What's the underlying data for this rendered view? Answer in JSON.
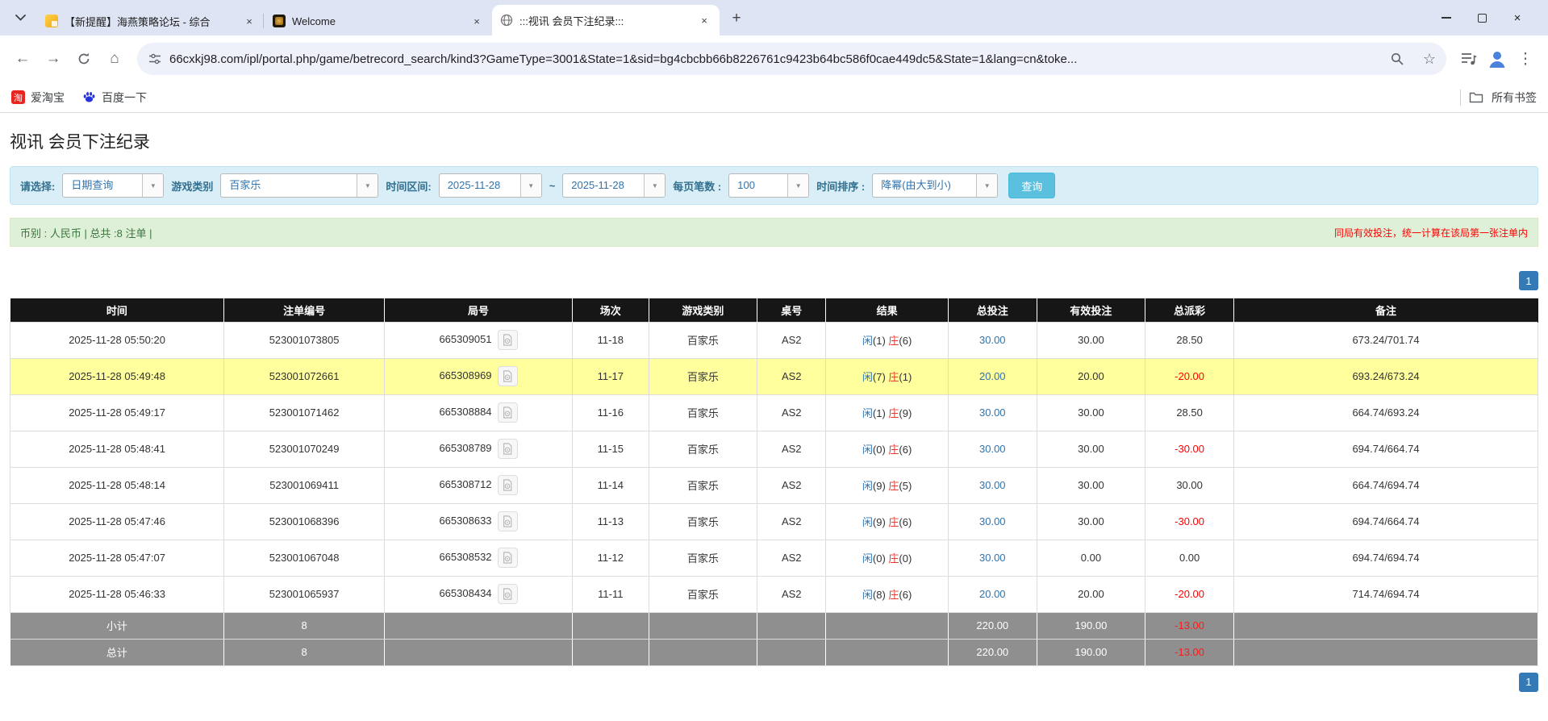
{
  "colors": {
    "accent_blue": "#337ab7",
    "link_blue": "#3173ad",
    "search_button": "#5bc0de",
    "row_highlight": "#ffff9e",
    "negative_red": "#ff0000",
    "result_zhuang_red": "#e03a2f",
    "table_header_bg": "#161616",
    "table_footer_bg": "#8f8f8f",
    "summary_bg": "#dff0d8",
    "filter_bg": "#daeef7"
  },
  "browser": {
    "tabs": [
      {
        "title": "【新提醒】海燕策略论坛 - 综合",
        "favicon": "gold-square-icon"
      },
      {
        "title": "Welcome",
        "favicon": "dark-gold-icon"
      },
      {
        "title": ":::视讯 会员下注纪录:::",
        "favicon": "globe-icon"
      }
    ],
    "icons": {
      "close_glyph": "×",
      "new_tab_glyph": "+",
      "back_glyph": "←",
      "forward_glyph": "→",
      "home_glyph": "⌂",
      "star_glyph": "☆",
      "kebab_glyph": "⋮",
      "dropdown_glyph": "▼"
    },
    "url": "66cxkj98.com/ipl/portal.php/game/betrecord_search/kind3?GameType=3001&State=1&sid=bg4cbcbb66b8226761c9423b64bc586f0cae449dc5&State=1&lang=cn&toke...",
    "bookmarks": {
      "items": [
        {
          "label": "爱淘宝",
          "icon_text": "淘"
        },
        {
          "label": "百度一下"
        }
      ],
      "all_bookmarks_label": "所有书签"
    }
  },
  "page": {
    "title": "视讯 会员下注纪录",
    "filters": {
      "select_label": "请选择:",
      "select_value": "日期查询",
      "game_type_label": "游戏类别",
      "game_type_value": "百家乐",
      "date_range_label": "时间区间:",
      "date_from": "2025-11-28",
      "tilde": "~",
      "date_to": "2025-11-28",
      "page_size_label": "每页笔数 :",
      "page_size_value": "100",
      "sort_label": "时间排序 :",
      "sort_value": "降幂(由大到小)",
      "search_button_label": "查询"
    },
    "summary": {
      "left": "币别 : 人民币 | 总共 :8 注单 |",
      "right": "同局有效投注，统一计算在该局第一张注单内"
    },
    "pagination": {
      "current": "1"
    },
    "table": {
      "headers": [
        "时间",
        "注单编号",
        "局号",
        "场次",
        "游戏类别",
        "桌号",
        "结果",
        "总投注",
        "有效投注",
        "总派彩",
        "备注"
      ],
      "rows": [
        {
          "time": "2025-11-28 05:50:20",
          "bet_no": "523001073805",
          "round_no": "665309051",
          "session": "11-18",
          "game": "百家乐",
          "table_no": "AS2",
          "xian": "闲",
          "xian_n": "(1)",
          "zhuang": "庄",
          "zhuang_n": "(6)",
          "total_bet": "30.00",
          "valid_bet": "30.00",
          "payout": "28.50",
          "payout_class": "",
          "row_class": "",
          "remark": "673.24/701.74"
        },
        {
          "time": "2025-11-28 05:49:48",
          "bet_no": "523001072661",
          "round_no": "665308969",
          "session": "11-17",
          "game": "百家乐",
          "table_no": "AS2",
          "xian": "闲",
          "xian_n": "(7)",
          "zhuang": "庄",
          "zhuang_n": "(1)",
          "total_bet": "20.00",
          "valid_bet": "20.00",
          "payout": "-20.00",
          "payout_class": "neg",
          "row_class": "highlight",
          "remark": "693.24/673.24"
        },
        {
          "time": "2025-11-28 05:49:17",
          "bet_no": "523001071462",
          "round_no": "665308884",
          "session": "11-16",
          "game": "百家乐",
          "table_no": "AS2",
          "xian": "闲",
          "xian_n": "(1)",
          "zhuang": "庄",
          "zhuang_n": "(9)",
          "total_bet": "30.00",
          "valid_bet": "30.00",
          "payout": "28.50",
          "payout_class": "",
          "row_class": "",
          "remark": "664.74/693.24"
        },
        {
          "time": "2025-11-28 05:48:41",
          "bet_no": "523001070249",
          "round_no": "665308789",
          "session": "11-15",
          "game": "百家乐",
          "table_no": "AS2",
          "xian": "闲",
          "xian_n": "(0)",
          "zhuang": "庄",
          "zhuang_n": "(6)",
          "total_bet": "30.00",
          "valid_bet": "30.00",
          "payout": "-30.00",
          "payout_class": "neg",
          "row_class": "",
          "remark": "694.74/664.74"
        },
        {
          "time": "2025-11-28 05:48:14",
          "bet_no": "523001069411",
          "round_no": "665308712",
          "session": "11-14",
          "game": "百家乐",
          "table_no": "AS2",
          "xian": "闲",
          "xian_n": "(9)",
          "zhuang": "庄",
          "zhuang_n": "(5)",
          "total_bet": "30.00",
          "valid_bet": "30.00",
          "payout": "30.00",
          "payout_class": "",
          "row_class": "",
          "remark": "664.74/694.74"
        },
        {
          "time": "2025-11-28 05:47:46",
          "bet_no": "523001068396",
          "round_no": "665308633",
          "session": "11-13",
          "game": "百家乐",
          "table_no": "AS2",
          "xian": "闲",
          "xian_n": "(9)",
          "zhuang": "庄",
          "zhuang_n": "(6)",
          "total_bet": "30.00",
          "valid_bet": "30.00",
          "payout": "-30.00",
          "payout_class": "neg",
          "row_class": "",
          "remark": "694.74/664.74"
        },
        {
          "time": "2025-11-28 05:47:07",
          "bet_no": "523001067048",
          "round_no": "665308532",
          "session": "11-12",
          "game": "百家乐",
          "table_no": "AS2",
          "xian": "闲",
          "xian_n": "(0)",
          "zhuang": "庄",
          "zhuang_n": "(0)",
          "total_bet": "30.00",
          "valid_bet": "0.00",
          "payout": "0.00",
          "payout_class": "",
          "row_class": "",
          "remark": "694.74/694.74"
        },
        {
          "time": "2025-11-28 05:46:33",
          "bet_no": "523001065937",
          "round_no": "665308434",
          "session": "11-11",
          "game": "百家乐",
          "table_no": "AS2",
          "xian": "闲",
          "xian_n": "(8)",
          "zhuang": "庄",
          "zhuang_n": "(6)",
          "total_bet": "20.00",
          "valid_bet": "20.00",
          "payout": "-20.00",
          "payout_class": "neg",
          "row_class": "",
          "remark": "714.74/694.74"
        }
      ],
      "subtotal": {
        "label": "小计",
        "count": "8",
        "total_bet": "220.00",
        "valid_bet": "190.00",
        "payout": "-13.00"
      },
      "total": {
        "label": "总计",
        "count": "8",
        "total_bet": "220.00",
        "valid_bet": "190.00",
        "payout": "-13.00"
      }
    }
  }
}
